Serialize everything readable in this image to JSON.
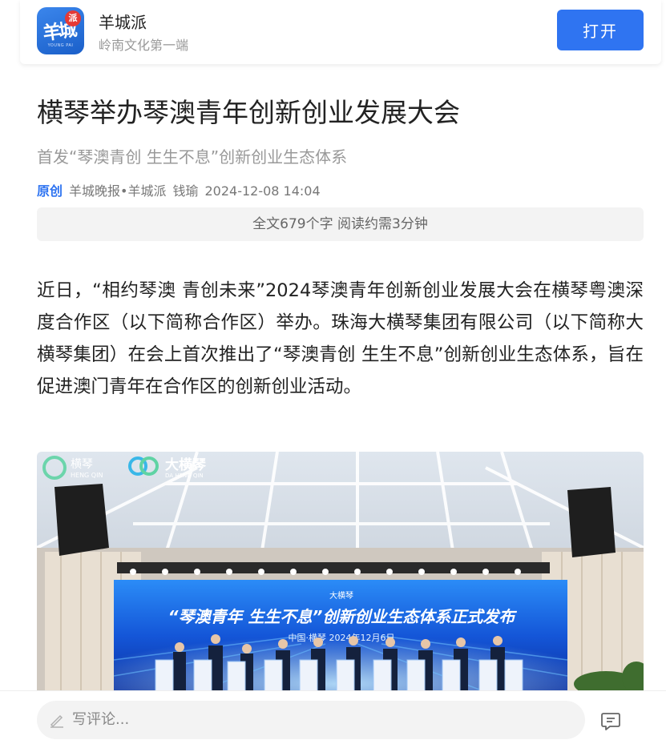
{
  "app_bar": {
    "logo_text": "羊城",
    "logo_badge": "派",
    "logo_sub": "YOUNG PAI",
    "name": "羊城派",
    "slogan": "岭南文化第一端",
    "open_label": "打开"
  },
  "article": {
    "title": "横琴举办琴澳青年创新创业发展大会",
    "subtitle": "首发“琴澳青创 生生不息”创新创业生态体系",
    "original_tag": "原创",
    "source": "羊城晚报•羊城派",
    "author": "钱瑜",
    "datetime": "2024-12-08 14:04",
    "reading_info": "全文679个字 阅读约需3分钟",
    "paragraph": "近日，“相约琴澳 青创未来”2024琴澳青年创新创业发展大会在横琴粤澳深度合作区（以下简称合作区）举办。珠海大横琴集团有限公司（以下简称大横琴集团）在会上首次推出了“琴澳青创 生生不息”创新创业生态体系，旨在促进澳门青年在合作区的创新创业活动。"
  },
  "photo": {
    "logo1": "横琴",
    "logo1_sub": "HENG QIN",
    "logo2": "大横琴",
    "logo2_sub": "DA HENG QIN",
    "screen_headline": "“琴澳青年 生生不息”创新创业生态体系正式发布",
    "screen_subline": "中国·横琴 2024年12月6日",
    "screen_brand": "大横琴"
  },
  "bottom_bar": {
    "comment_placeholder": "写评论..."
  },
  "colors": {
    "accent": "#2f74f1",
    "muted": "#999999",
    "screen_blue": "#1456d8"
  }
}
